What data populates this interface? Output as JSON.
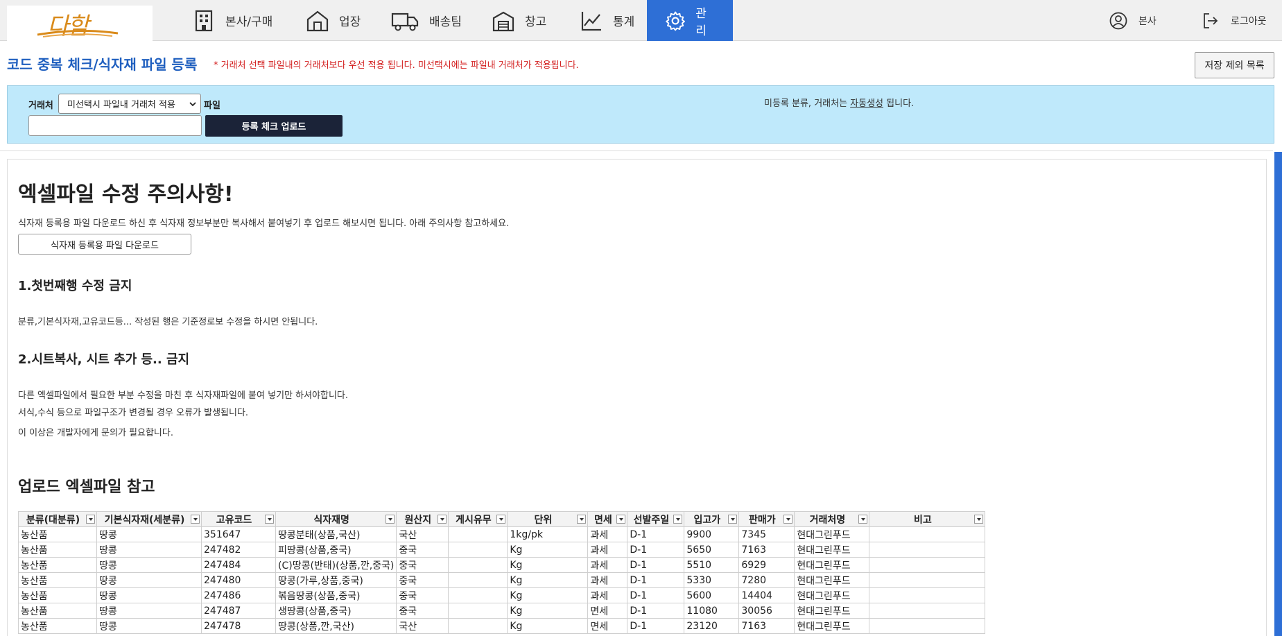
{
  "nav": {
    "logo_text": "다함",
    "items": [
      {
        "label": "본사/구매",
        "icon": "building-icon"
      },
      {
        "label": "업장",
        "icon": "store-icon"
      },
      {
        "label": "배송팀",
        "icon": "truck-icon"
      },
      {
        "label": "창고",
        "icon": "warehouse-icon"
      },
      {
        "label": "통계",
        "icon": "chart-icon"
      },
      {
        "label": "관리",
        "icon": "gear-icon",
        "active": true
      }
    ],
    "user_label": "본사",
    "logout_label": "로그아웃"
  },
  "header": {
    "title": "코드 중복 체크/식자재 파일 등록",
    "note": "* 거래처 선택 파일내의 거래처보다 우선 적용 됩니다. 미선택시에는 파일내 거래처가 적용됩니다.",
    "excluded_button": "저장 제외 목록"
  },
  "filter": {
    "vendor_label": "거래처",
    "vendor_selected": "미선택시 파일내 거래처 적용",
    "file_label": "파일",
    "upload_button": "등록 체크 업로드",
    "auto_note_pre": "미등록 분류, 거래처는 ",
    "auto_note_link": "자동생성",
    "auto_note_post": " 됩니다."
  },
  "guide": {
    "title": "엑셀파일 수정 주의사항!",
    "intro": "식자재 등록용 파일 다운로드 하신 후 식자재 정보부분만 복사해서 붙여넣기 후 업로드 해보시면 됩니다. 아래 주의사항 참고하세요.",
    "download_button": "식자재 등록용 파일 다운로드",
    "rule1_title": "1.첫번째행 수정 금지",
    "rule1_text": "분류,기본식자재,고유코드등... 작성된 행은 기준정로보 수정을 하시면 안됩니다.",
    "rule2_title": "2.시트복사, 시트 추가 등.. 금지",
    "rule2_text1": "다른 엑셀파일에서 필요한 부분 수정을 마친 후 식자재파일에 붙여 넣기만 하셔야합니다.",
    "rule2_text2": "서식,수식 등으로 파일구조가 변경될 경우 오류가 발생됩니다.",
    "rule2_text3": "이 이상은 개발자에게 문의가 필요합니다.",
    "ref_title": "업로드 엑셀파일 참고"
  },
  "excel": {
    "headers": [
      "분류(대분류)",
      "기본식자재(세분류)",
      "고유코드",
      "식자재명",
      "원산지",
      "게시유무",
      "단위",
      "면세",
      "선발주일",
      "입고가",
      "판매가",
      "거래처명",
      "비고"
    ],
    "rows": [
      [
        "농산품",
        "땅콩",
        "351647",
        "땅콩분태(상품,국산)",
        "국산",
        "",
        "1kg/pk",
        "과세",
        "D-1",
        "9900",
        "7345",
        "현대그린푸드",
        ""
      ],
      [
        "농산품",
        "땅콩",
        "247482",
        "피땅콩(상품,중국)",
        "중국",
        "",
        "Kg",
        "과세",
        "D-1",
        "5650",
        "7163",
        "현대그린푸드",
        ""
      ],
      [
        "농산품",
        "땅콩",
        "247484",
        "(C)땅콩(반태)(상품,깐,중국)",
        "중국",
        "",
        "Kg",
        "과세",
        "D-1",
        "5510",
        "6929",
        "현대그린푸드",
        ""
      ],
      [
        "농산품",
        "땅콩",
        "247480",
        "땅콩(가루,상품,중국)",
        "중국",
        "",
        "Kg",
        "과세",
        "D-1",
        "5330",
        "7280",
        "현대그린푸드",
        ""
      ],
      [
        "농산품",
        "땅콩",
        "247486",
        "볶음땅콩(상품,중국)",
        "중국",
        "",
        "Kg",
        "과세",
        "D-1",
        "5600",
        "14404",
        "현대그린푸드",
        ""
      ],
      [
        "농산품",
        "땅콩",
        "247487",
        "생땅콩(상품,중국)",
        "중국",
        "",
        "Kg",
        "면세",
        "D-1",
        "11080",
        "30056",
        "현대그린푸드",
        ""
      ],
      [
        "농산품",
        "땅콩",
        "247478",
        "땅콩(상품,깐,국산)",
        "국산",
        "",
        "Kg",
        "면세",
        "D-1",
        "23120",
        "7163",
        "현대그린푸드",
        ""
      ]
    ]
  }
}
